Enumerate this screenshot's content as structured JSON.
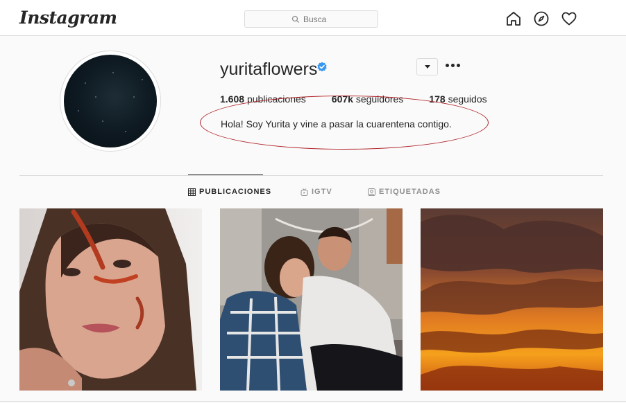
{
  "nav": {
    "logo": "Instagram",
    "search_placeholder": "Busca",
    "icons": [
      "home-icon",
      "explore-icon",
      "activity-heart-icon"
    ]
  },
  "profile": {
    "username": "yuritaflowers",
    "verified": true,
    "stats": {
      "posts_count": "1.608",
      "posts_label": "publicaciones",
      "followers_count": "607k",
      "followers_label": "seguidores",
      "following_count": "178",
      "following_label": "seguidos"
    },
    "bio": "Hola! Soy Yurita y vine a pasar la cuarentena contigo."
  },
  "tabs": [
    {
      "label": "PUBLICACIONES",
      "active": true,
      "icon": "grid-icon"
    },
    {
      "label": "IGTV",
      "active": false,
      "icon": "igtv-icon"
    },
    {
      "label": "ETIQUETADAS",
      "active": false,
      "icon": "tagged-icon"
    }
  ],
  "posts": [
    {
      "subject": "selfie with koi fish face filter"
    },
    {
      "subject": "couple embracing outdoors"
    },
    {
      "subject": "orange sunset clouds"
    }
  ],
  "colors": {
    "accent_verified": "#3897f0",
    "annotation": "#b02228",
    "border": "#dbdbdb",
    "text": "#262626",
    "muted": "#8e8e8e"
  }
}
